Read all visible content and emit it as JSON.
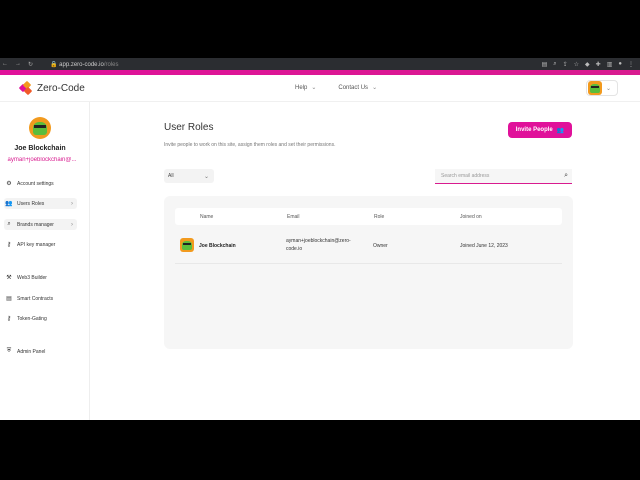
{
  "browser": {
    "url_host": "app.zero-code.io",
    "url_path": "/roles"
  },
  "header": {
    "brand": "Zero-Code",
    "nav": [
      {
        "label": "Help"
      },
      {
        "label": "Contact Us"
      }
    ]
  },
  "profile": {
    "name": "Joe Blockchain",
    "email": "ayman+joeblockchain@..."
  },
  "sidebar": {
    "items": [
      {
        "label": "Account settings",
        "icon": "gear-icon"
      },
      {
        "label": "Users Roles",
        "icon": "users-icon"
      },
      {
        "label": "Brands manager",
        "icon": "search-icon"
      },
      {
        "label": "API key manager",
        "icon": "key-icon"
      },
      {
        "label": "Web3 Builder",
        "icon": "hammer-icon"
      },
      {
        "label": "Smart Contracts",
        "icon": "contract-icon"
      },
      {
        "label": "Token-Gating",
        "icon": "key-icon"
      },
      {
        "label": "Admin Panel",
        "icon": "admin-icon"
      }
    ]
  },
  "main": {
    "title": "User Roles",
    "subtitle": "Invite people to work on this site, assign them roles and set their permissions.",
    "invite_label": "Invite People",
    "filter_value": "All",
    "search_placeholder": "Search email address",
    "table": {
      "columns": [
        "Name",
        "Email",
        "Role",
        "Joined on"
      ],
      "rows": [
        {
          "name": "Joe Blockchain",
          "email": "ayman+joeblockchain@zero-code.io",
          "role": "Owner",
          "joined": "Joined June 12, 2023"
        }
      ]
    }
  },
  "colors": {
    "accent": "#e0119a",
    "avatar_bg": "#f29a1e",
    "avatar_face": "#5bbd3b"
  }
}
